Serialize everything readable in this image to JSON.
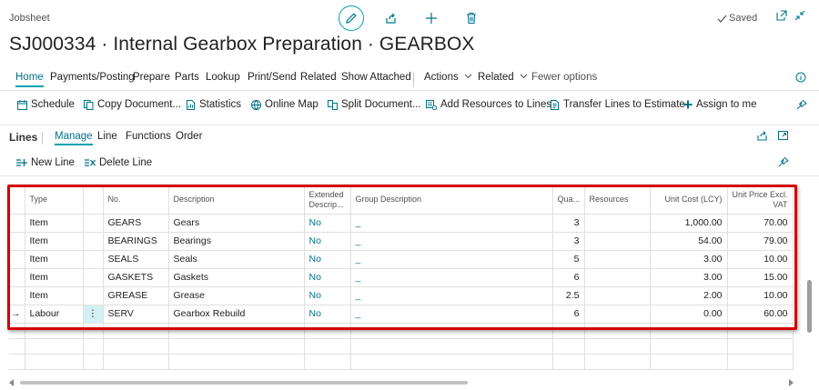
{
  "header": {
    "page_kind": "Jobsheet",
    "title": "SJ000334 · Internal Gearbox Preparation · GEARBOX",
    "saved_label": "Saved"
  },
  "menu": {
    "items": [
      "Home",
      "Payments/Posting",
      "Prepare",
      "Parts",
      "Lookup",
      "Print/Send",
      "Related",
      "Show Attached"
    ],
    "actions_label": "Actions",
    "related_label": "Related",
    "fewer_label": "Fewer options"
  },
  "actions": [
    "Schedule",
    "Copy Document...",
    "Statistics",
    "Online Map",
    "Split Document...",
    "Add Resources to Lines",
    "Transfer Lines to Estimate",
    "Assign to me"
  ],
  "lines": {
    "title": "Lines",
    "tabs": [
      "Manage",
      "Line",
      "Functions",
      "Order"
    ],
    "new_line": "New Line",
    "delete_line": "Delete Line"
  },
  "grid": {
    "columns": {
      "type": "Type",
      "no": "No.",
      "description": "Description",
      "extended_1": "Extended",
      "extended_2": "Descrip...",
      "group": "Group Description",
      "qty": "Qua...",
      "resources": "Resources",
      "unit_cost": "Unit Cost (LCY)",
      "unit_price_1": "Unit Price Excl.",
      "unit_price_2": "VAT"
    },
    "rows": [
      {
        "type": "Item",
        "no": "GEARS",
        "description": "Gears",
        "extended": "No",
        "group": "_",
        "qty": "3",
        "resources": "",
        "unit_cost": "1,000.00",
        "unit_price": "70.00"
      },
      {
        "type": "Item",
        "no": "BEARINGS",
        "description": "Bearings",
        "extended": "No",
        "group": "_",
        "qty": "3",
        "resources": "",
        "unit_cost": "54.00",
        "unit_price": "79.00"
      },
      {
        "type": "Item",
        "no": "SEALS",
        "description": "Seals",
        "extended": "No",
        "group": "_",
        "qty": "5",
        "resources": "",
        "unit_cost": "3.00",
        "unit_price": "10.00"
      },
      {
        "type": "Item",
        "no": "GASKETS",
        "description": "Gaskets",
        "extended": "No",
        "group": "_",
        "qty": "6",
        "resources": "",
        "unit_cost": "3.00",
        "unit_price": "15.00"
      },
      {
        "type": "Item",
        "no": "GREASE",
        "description": "Grease",
        "extended": "No",
        "group": "_",
        "qty": "2.5",
        "resources": "",
        "unit_cost": "2.00",
        "unit_price": "10.00"
      },
      {
        "type": "Labour",
        "no": "SERV",
        "description": "Gearbox Rebuild",
        "extended": "No",
        "group": "_",
        "qty": "6",
        "resources": "",
        "unit_cost": "0.00",
        "unit_price": "60.00",
        "selected": true,
        "row_arrow": "→",
        "row_menu": "⋮"
      }
    ]
  },
  "colors": {
    "accent": "#00a2b3",
    "link": "#00728a",
    "highlight_border": "#d40000"
  }
}
